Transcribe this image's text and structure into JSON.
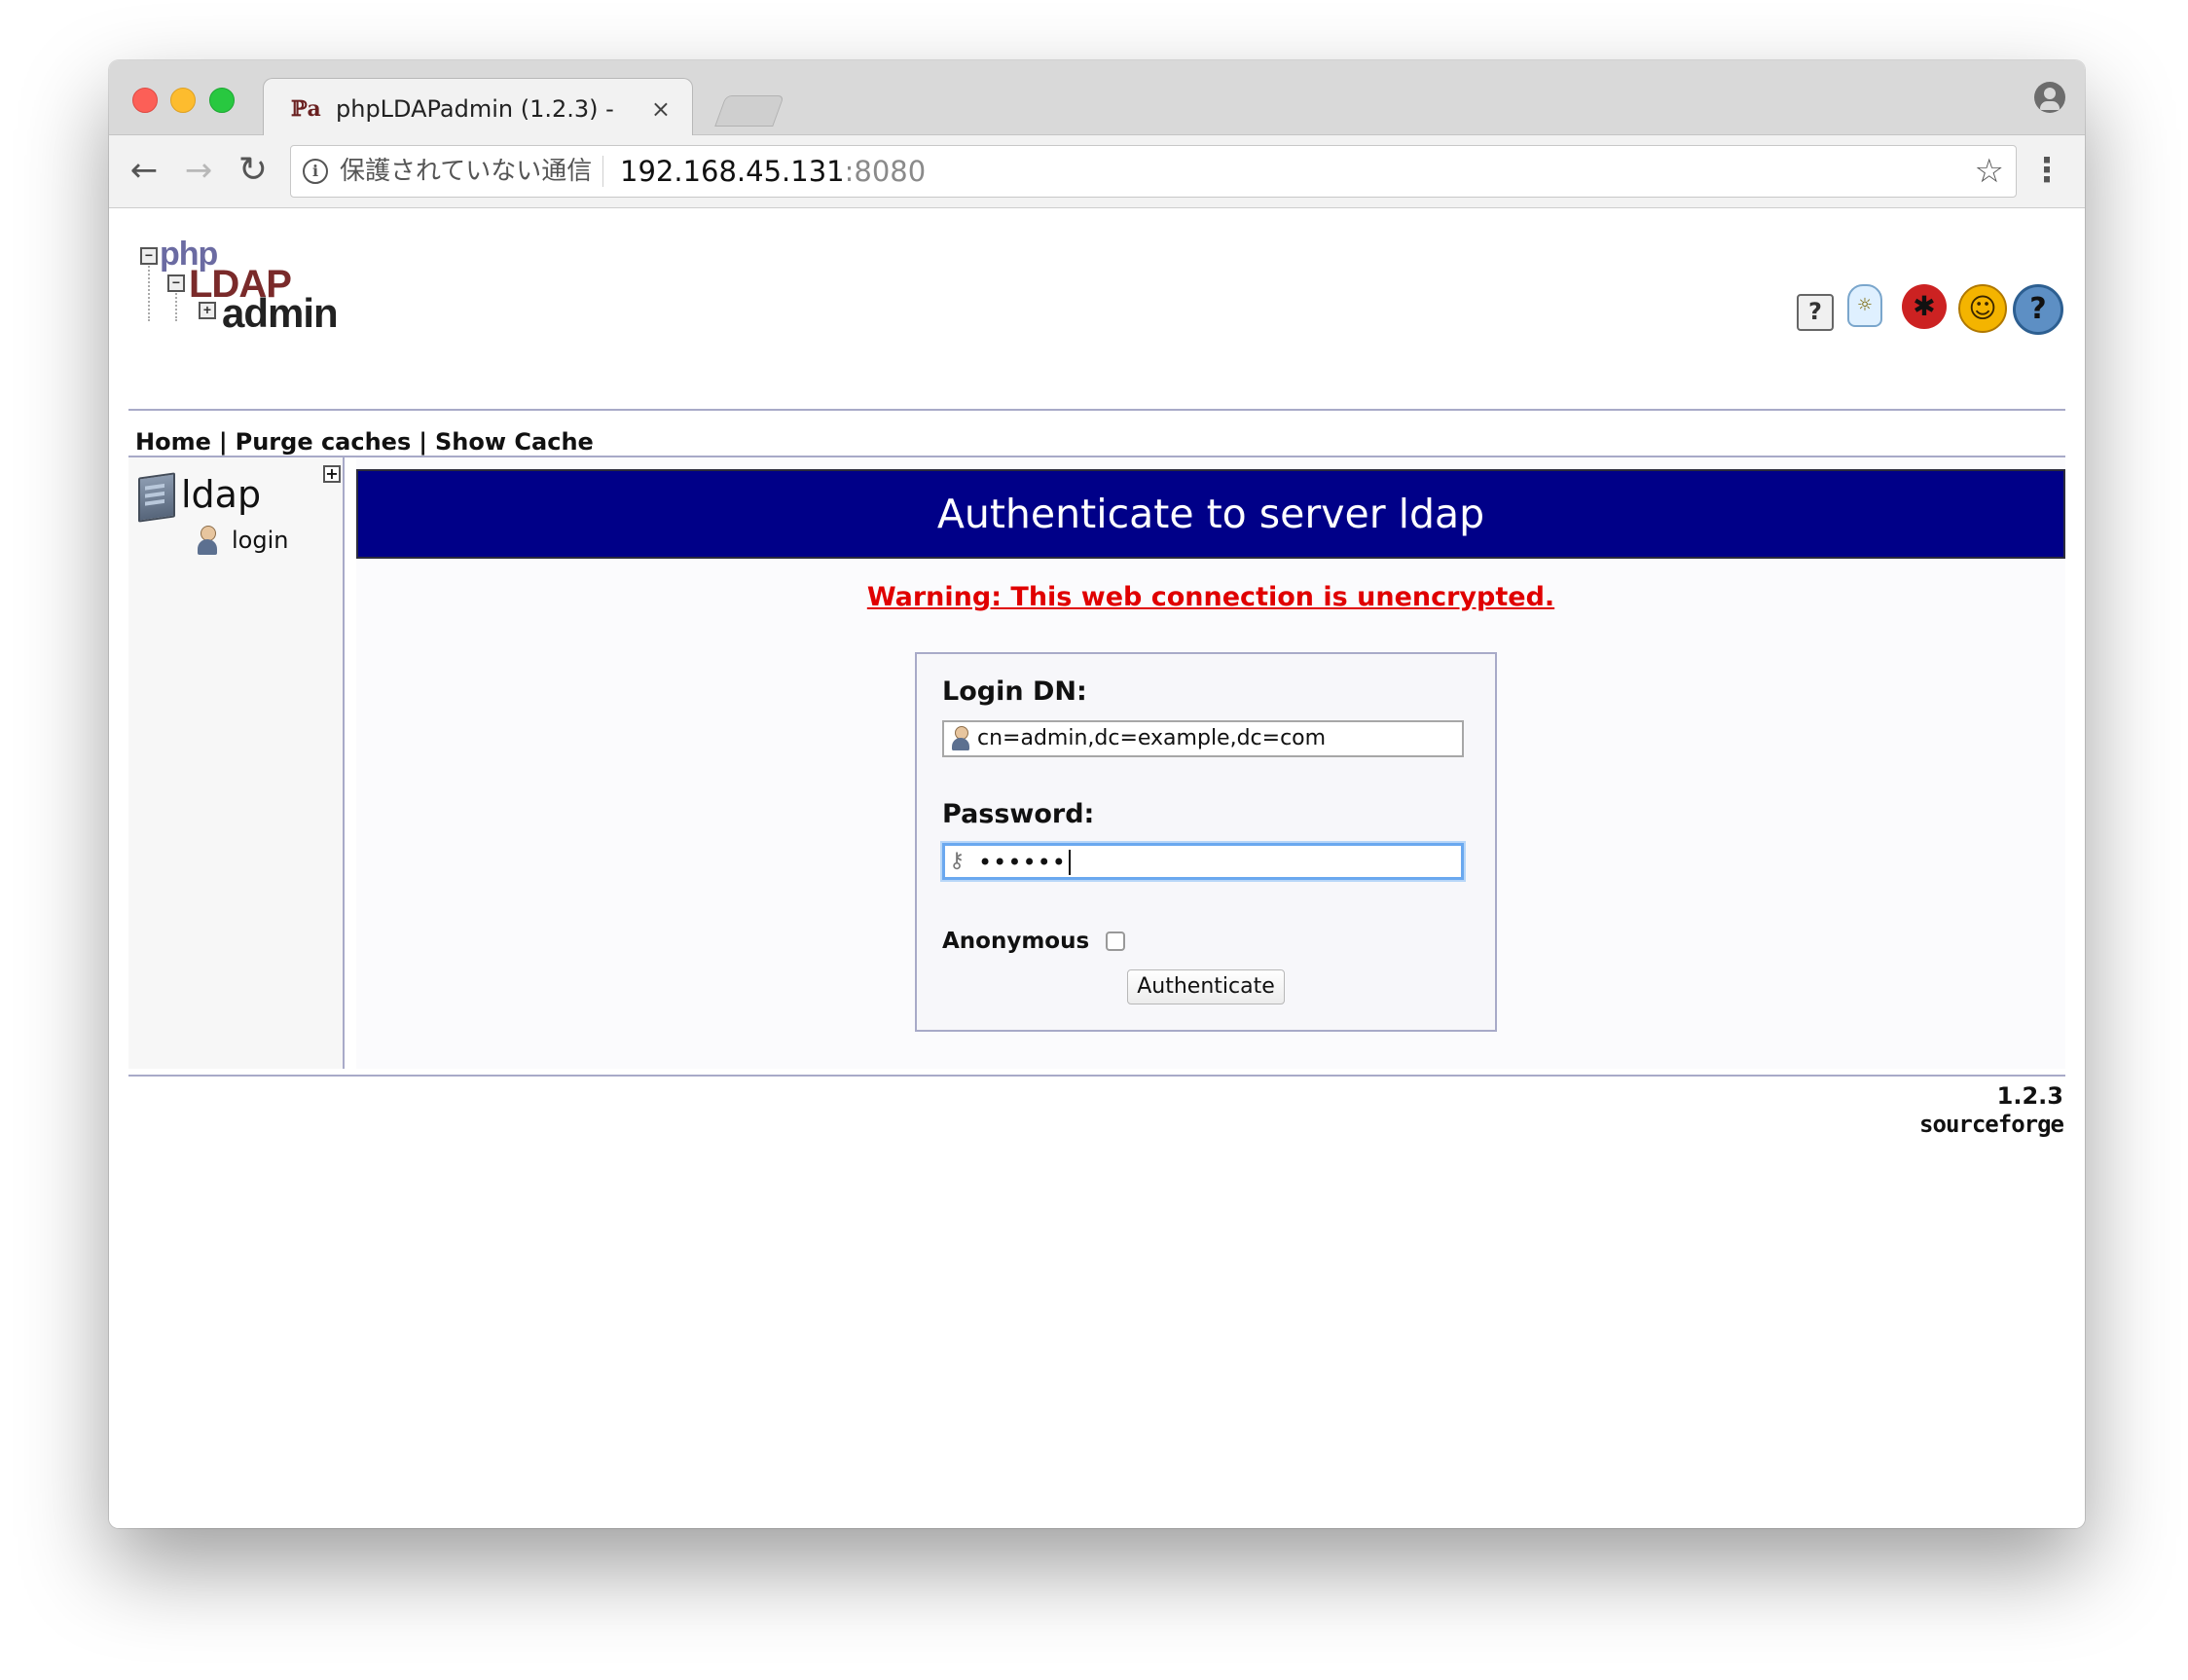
{
  "browser": {
    "tab_title": "phpLDAPadmin (1.2.3) -",
    "tab_close": "×",
    "security_label": "保護されていない通信",
    "url_host": "192.168.45.131",
    "url_port": ":8080",
    "icons": {
      "back": "arrow-left-icon",
      "forward": "arrow-right-icon",
      "reload": "reload-icon",
      "info": "info-icon",
      "bookmark": "star-icon",
      "menu": "more-vert-icon",
      "profile": "profile-icon"
    }
  },
  "app": {
    "logo": {
      "php": "php",
      "ldap": "LDAP",
      "admin": "admin"
    },
    "header_icons": [
      "help-icon",
      "lightbulb-icon",
      "bug-icon",
      "smile-icon",
      "question-icon"
    ],
    "menu": {
      "home": "Home",
      "purge_caches": "Purge caches",
      "show_cache": "Show Cache",
      "separator": "|"
    },
    "tree": {
      "server": "ldap",
      "login": "login"
    },
    "main": {
      "title": "Authenticate to server ldap",
      "warning": "Warning: This web connection is unencrypted.",
      "login_dn_label": "Login DN:",
      "login_dn_value": "cn=admin,dc=example,dc=com",
      "password_label": "Password:",
      "password_value": "••••••",
      "anonymous_label": "Anonymous",
      "anonymous_checked": false,
      "authenticate_button": "Authenticate"
    },
    "footer": {
      "version": "1.2.3",
      "sourceforge": "sourceforge"
    }
  }
}
